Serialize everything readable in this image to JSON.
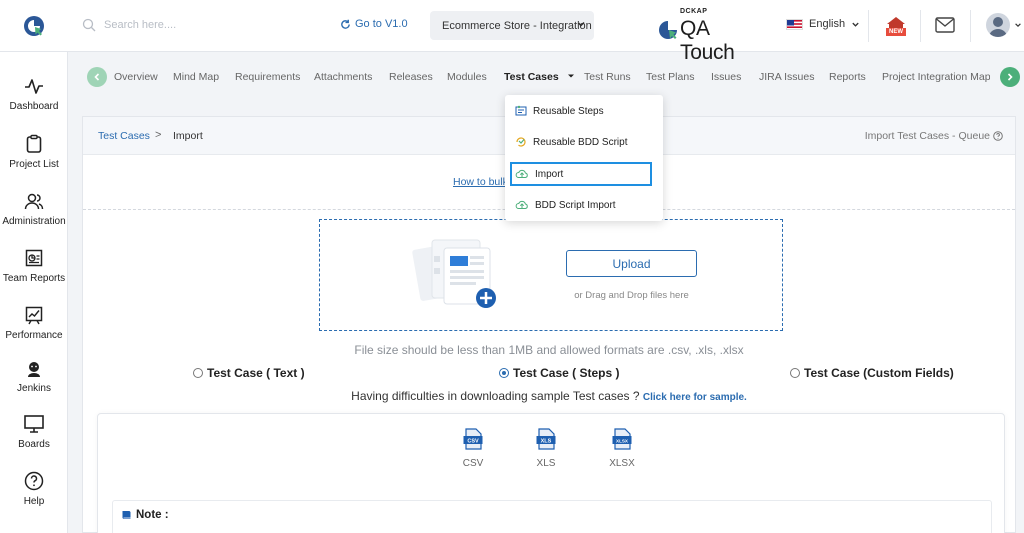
{
  "header": {
    "search_placeholder": "Search here....",
    "goto_label": "Go to V1.0",
    "project_selected": "Ecommerce Store - Integration",
    "brand_small": "DCKAP",
    "brand_name": "QA Touch",
    "language": "English",
    "new_badge": "NEW"
  },
  "sidebar": {
    "items": [
      {
        "label": "Dashboard"
      },
      {
        "label": "Project List"
      },
      {
        "label": "Administration"
      },
      {
        "label": "Team Reports"
      },
      {
        "label": "Performance"
      },
      {
        "label": "Jenkins"
      },
      {
        "label": "Boards"
      },
      {
        "label": "Help"
      }
    ]
  },
  "tabs": [
    {
      "label": "Overview"
    },
    {
      "label": "Mind Map"
    },
    {
      "label": "Requirements"
    },
    {
      "label": "Attachments"
    },
    {
      "label": "Releases"
    },
    {
      "label": "Modules"
    },
    {
      "label": "Test Cases"
    },
    {
      "label": "Test Runs"
    },
    {
      "label": "Test Plans"
    },
    {
      "label": "Issues"
    },
    {
      "label": "JIRA Issues"
    },
    {
      "label": "Reports"
    },
    {
      "label": "Project Integration Mapp"
    }
  ],
  "dropdown": {
    "items": [
      {
        "label": "Reusable Steps"
      },
      {
        "label": "Reusable BDD Script"
      },
      {
        "label": "Import"
      },
      {
        "label": "BDD Script Import"
      }
    ]
  },
  "breadcrumb": {
    "parent": "Test Cases",
    "separator": ">",
    "current": "Import"
  },
  "queue_label": "Import Test Cases - Queue",
  "howto_link": "How to bulk",
  "upload": {
    "button": "Upload",
    "hint": "or Drag and Drop files here"
  },
  "file_size_note": "File size should be less than 1MB and allowed formats are .csv, .xls, .xlsx",
  "import_types": [
    {
      "label": "Test Case ( Text )",
      "selected": false
    },
    {
      "label": "Test Case ( Steps )",
      "selected": true
    },
    {
      "label": "Test Case (Custom Fields)",
      "selected": false
    }
  ],
  "difficulty": {
    "text": "Having difficulties in downloading sample Test cases ? ",
    "link": "Click here for sample."
  },
  "formats": [
    {
      "label": "CSV",
      "icon_text": "CSV"
    },
    {
      "label": "XLS",
      "icon_text": "XLS"
    },
    {
      "label": "XLSX",
      "icon_text": "XLSX"
    }
  ],
  "note_label": "Note :",
  "colors": {
    "accent_blue": "#2b6cb0",
    "accent_green": "#4caf7a",
    "highlight_border": "#1e8fe1"
  }
}
